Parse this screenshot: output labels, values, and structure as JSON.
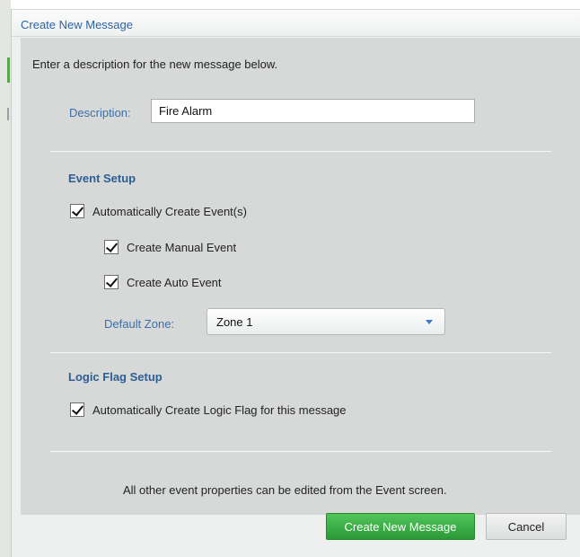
{
  "dialog": {
    "title": "Create New Message",
    "intro": "Enter a description for the new message below."
  },
  "description": {
    "label": "Description:",
    "value": "Fire Alarm"
  },
  "event_setup": {
    "heading": "Event Setup",
    "auto_create_events": {
      "label": "Automatically Create Event(s)",
      "checked": true
    },
    "create_manual_event": {
      "label": "Create Manual Event",
      "checked": true
    },
    "create_auto_event": {
      "label": "Create Auto Event",
      "checked": true
    },
    "default_zone": {
      "label": "Default Zone:",
      "value": "Zone 1"
    }
  },
  "logic_flag_setup": {
    "heading": "Logic Flag Setup",
    "auto_create_logic_flag": {
      "label": "Automatically Create Logic Flag for this message",
      "checked": true
    }
  },
  "footer_note": "All other event properties can be edited from the Event screen.",
  "buttons": {
    "create": "Create New Message",
    "cancel": "Cancel"
  },
  "colors": {
    "accent_text": "#3a6fa8",
    "section_heading": "#2c5e95",
    "create_button": "#2a9a36",
    "panel": "#d7d9d9"
  },
  "icons": {
    "dropdown": "chevron-down-icon",
    "checkbox": "checkmark-icon"
  }
}
